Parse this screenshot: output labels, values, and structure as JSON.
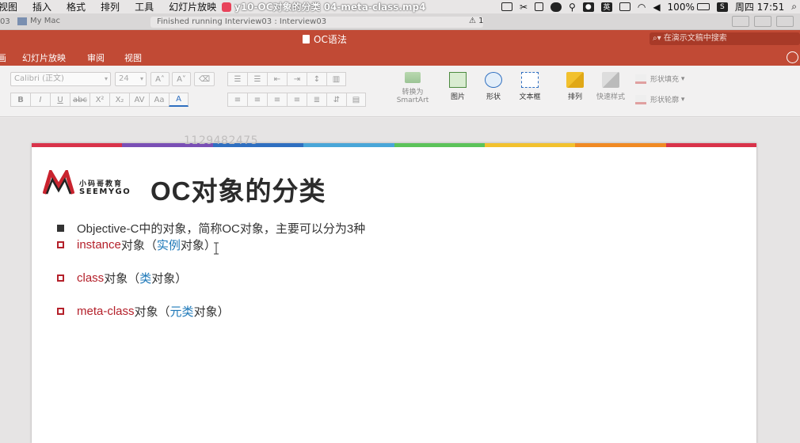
{
  "menubar": {
    "items": [
      "视图",
      "插入",
      "格式",
      "排列",
      "工具",
      "幻灯片放映"
    ],
    "video_title": "y10-OC对象的分类 04-meta-class.mp4",
    "lang": "英",
    "battery": "100%",
    "clock": "周四 17:51"
  },
  "tabsbar": {
    "left_fragment": "03",
    "host": "My Mac",
    "status": "Finished running Interview03 : Interview03",
    "warning_count": "1"
  },
  "titlebar": {
    "document": "OC语法",
    "search_placeholder": "在演示文稿中搜索"
  },
  "ribbon_tabs": [
    "画",
    "幻灯片放映",
    "审阅",
    "视图"
  ],
  "ribbon": {
    "font_name": "Calibri (正文)",
    "font_size": "24",
    "format_buttons": [
      "B",
      "I",
      "U",
      "abc",
      "X²",
      "X₂",
      "AV",
      "Aa",
      "A"
    ],
    "convert_smartart_line1": "转换为",
    "convert_smartart_line2": "SmartArt",
    "picture": "图片",
    "shape": "形状",
    "textbox": "文本框",
    "arrange": "排列",
    "quick_styles": "快速样式",
    "shape_fill": "形状填充",
    "shape_outline": "形状轮廓"
  },
  "watermark": "1129482475",
  "slide": {
    "logo_cn": "小码哥教育",
    "logo_en": "SEEMYGO",
    "title": "OC对象的分类",
    "bullet1": "Objective-C中的对象，简称OC对象，主要可以分为3种",
    "item1_red": "instance",
    "item1_mid": "对象（",
    "item1_blue": "实例",
    "item1_end": "对象）",
    "item2_red": "class",
    "item2_mid": "对象（",
    "item2_blue": "类",
    "item2_end": "对象）",
    "item3_red": "meta-class",
    "item3_mid": "对象（",
    "item3_blue": "元类",
    "item3_end": "对象）"
  },
  "colors": {
    "brand_red": "#c14a35",
    "accent_red": "#b4202a",
    "accent_blue": "#1e78b8",
    "stripe": [
      "#d9334a",
      "#7a4fb5",
      "#2f6fc0",
      "#49a6d8",
      "#5cc35a",
      "#f2c12e",
      "#f08a24",
      "#d9334a"
    ]
  }
}
